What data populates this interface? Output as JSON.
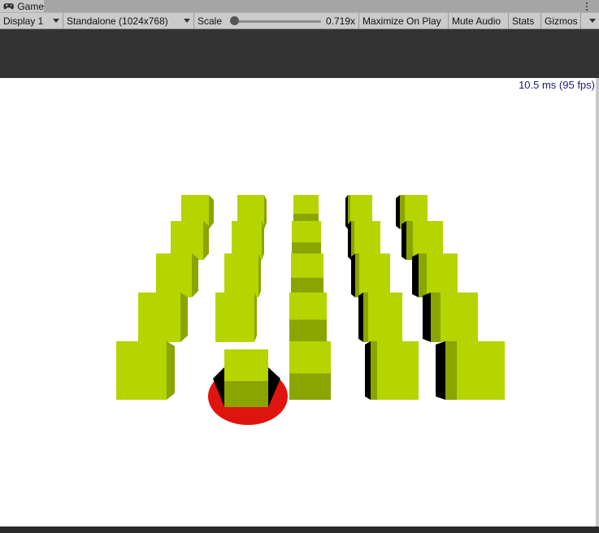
{
  "tab": {
    "icon": "gamepad-icon",
    "label": "Game"
  },
  "toolbar": {
    "display_label": "Display 1",
    "resolution_label": "Standalone (1024x768)",
    "scale_label": "Scale",
    "scale_value": "0.719x",
    "scale_level": 0.0,
    "maximize_label": "Maximize On Play",
    "mute_label": "Mute Audio",
    "stats_label": "Stats",
    "gizmos_label": "Gizmos"
  },
  "game": {
    "fps_text": "10.5 ms (95 fps)",
    "background_color": "#ffffff",
    "cube_color": "#b5d400",
    "cube_side_color": "#8aa500",
    "shadow_color": "#000000",
    "target_color": "#e0140e"
  }
}
